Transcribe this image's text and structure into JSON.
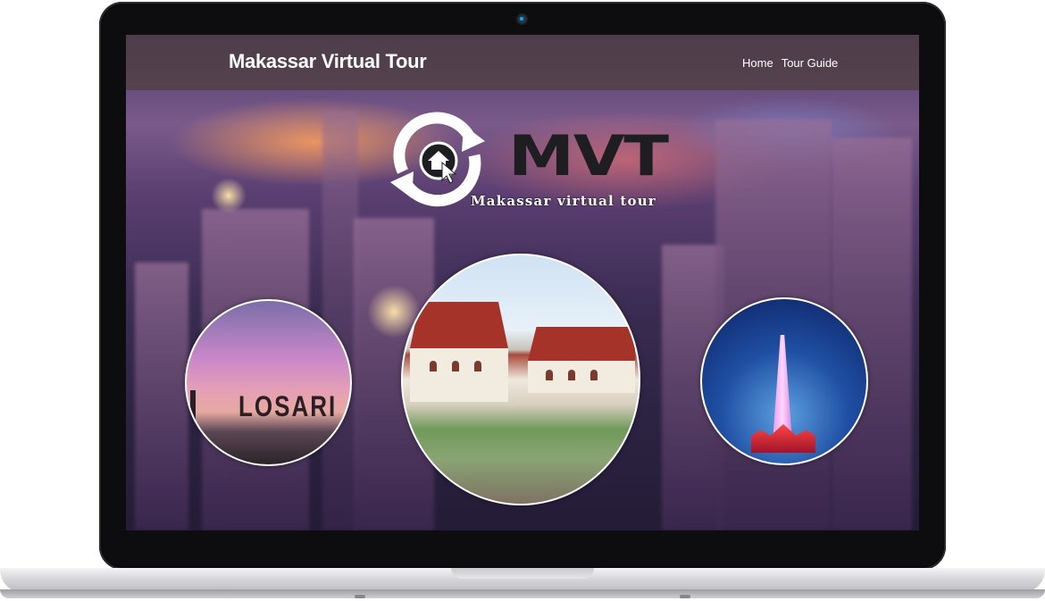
{
  "site": {
    "title": "Makassar Virtual Tour",
    "nav": [
      "Home",
      "Tour Guide"
    ]
  },
  "logo": {
    "acronym": "MVT",
    "tagline": "Makassar virtual tour"
  },
  "gallery": {
    "left_sign": "LOSARI"
  }
}
